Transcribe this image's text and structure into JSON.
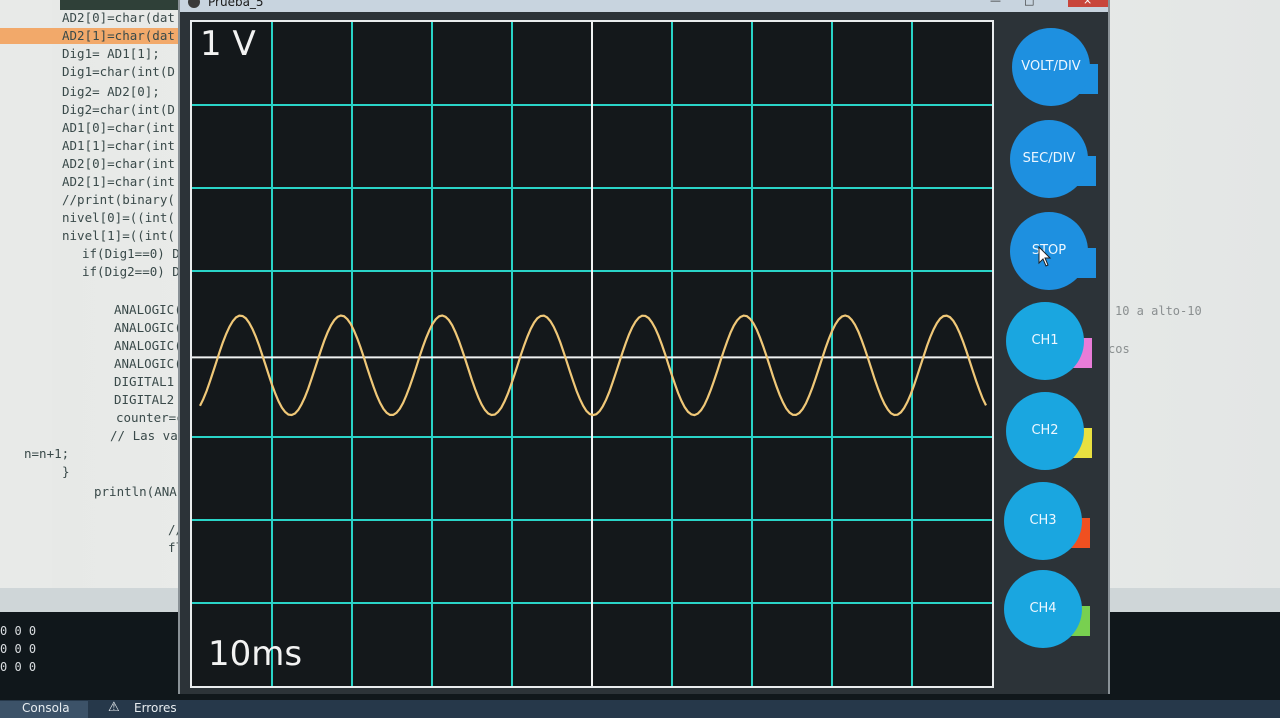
{
  "window": {
    "title": "Prueba_5"
  },
  "scope": {
    "volt_div_label": "1 V",
    "time_div_label": "10ms",
    "colors": {
      "background": "#14181b",
      "grid": "#2ad4c8",
      "axis": "#f0f2f2",
      "trace": "#f0c878"
    },
    "waveform": {
      "cycles": 7.8,
      "amplitude_v": 0.6
    }
  },
  "controls": {
    "buttons": [
      {
        "label": "VOLT/DIV",
        "color": "#1e90e0",
        "tab_color": "#1e90e0"
      },
      {
        "label": "SEC/DIV",
        "color": "#1e90e0",
        "tab_color": "#1e90e0"
      },
      {
        "label": "STOP",
        "color": "#1e90e0",
        "tab_color": "#1e90e0"
      },
      {
        "label": "CH1",
        "color": "#1aa6e0",
        "tab_color": "#e87cd8"
      },
      {
        "label": "CH2",
        "color": "#1aa6e0",
        "tab_color": "#e8e040"
      },
      {
        "label": "CH3",
        "color": "#1aa6e0",
        "tab_color": "#f05020"
      },
      {
        "label": "CH4",
        "color": "#1aa6e0",
        "tab_color": "#78d050"
      }
    ]
  },
  "ide": {
    "code_lines": [
      {
        "text": "AD2[0]=char(dat",
        "indent": 62,
        "hl": false
      },
      {
        "text": "AD2[1]=char(dat",
        "indent": 62,
        "hl": true
      },
      {
        "text": "Dig1= AD1[1];",
        "indent": 62,
        "hl": false
      },
      {
        "text": "Dig1=char(int(D",
        "indent": 62,
        "hl": false
      },
      {
        "text": "Dig2= AD2[0];",
        "indent": 62,
        "hl": false
      },
      {
        "text": "Dig2=char(int(D",
        "indent": 62,
        "hl": false
      },
      {
        "text": "AD1[0]=char(int",
        "indent": 62,
        "hl": false
      },
      {
        "text": "AD1[1]=char(int",
        "indent": 62,
        "hl": false
      },
      {
        "text": "AD2[0]=char(int",
        "indent": 62,
        "hl": false
      },
      {
        "text": "AD2[1]=char(int",
        "indent": 62,
        "hl": false
      },
      {
        "text": "//print(binary(",
        "indent": 62,
        "hl": false
      },
      {
        "text": "nivel[0]=((int(",
        "indent": 62,
        "hl": false
      },
      {
        "text": "nivel[1]=((int(",
        "indent": 62,
        "hl": false
      },
      {
        "text": "if(Dig1==0) D",
        "indent": 82,
        "hl": false
      },
      {
        "text": "if(Dig2==0) D",
        "indent": 82,
        "hl": false
      },
      {
        "text": "",
        "indent": 82,
        "hl": false
      },
      {
        "text": "ANALOGIC(",
        "indent": 114,
        "hl": false
      },
      {
        "text": "ANALOGIC(",
        "indent": 114,
        "hl": false
      },
      {
        "text": "ANALOGIC(",
        "indent": 114,
        "hl": false
      },
      {
        "text": "ANALOGIC(",
        "indent": 114,
        "hl": false
      },
      {
        "text": "DIGITAL1",
        "indent": 114,
        "hl": false
      },
      {
        "text": "DIGITAL2",
        "indent": 114,
        "hl": false
      },
      {
        "text": "counter=c",
        "indent": 116,
        "hl": false
      },
      {
        "text": "// Las va",
        "indent": 110,
        "hl": false
      },
      {
        "text": "n=n+1;",
        "indent": 24,
        "hl": false
      },
      {
        "text": "}",
        "indent": 62,
        "hl": false
      },
      {
        "text": "println(ANAL",
        "indent": 94,
        "hl": false
      },
      {
        "text": "",
        "indent": 94,
        "hl": false
      },
      {
        "text": "//C",
        "indent": 168,
        "hl": false
      },
      {
        "text": "fla",
        "indent": 168,
        "hl": false
      }
    ],
    "right_text": [
      {
        "text": "10 a alto-10"
      },
      {
        "text": "cos"
      }
    ],
    "console_lines": [
      "0 0 0",
      "0 0 0",
      "0 0 0"
    ],
    "tabs": {
      "console": "Consola",
      "errors": "Errores"
    }
  }
}
